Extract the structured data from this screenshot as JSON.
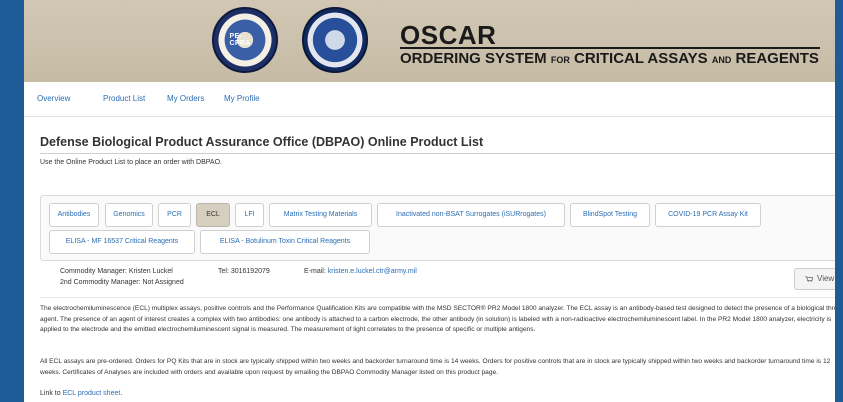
{
  "banner": {
    "seal_left_text": "PE-CPRA",
    "title": "OSCAR",
    "subtitle_parts": [
      "ORDERING SYSTEM",
      "FOR",
      "CRITICAL ASSAYS",
      "AND",
      "REAGENTS"
    ]
  },
  "nav": {
    "items": [
      "Overview",
      "Product List",
      "My Orders",
      "My Profile"
    ]
  },
  "page": {
    "title": "Defense Biological Product Assurance Office (DBPAO) Online Product List",
    "intro": "Use the Online Product List to place an order with DBPAO."
  },
  "tabs": {
    "row1": [
      "Antibodies",
      "Genomics",
      "PCR",
      "ECL",
      "LFI",
      "Matrix Testing Materials",
      "Inactivated non-BSAT Surrogates (iSURrogates)",
      "BlindSpot Testing",
      "COVID-19 PCR Assay Kit"
    ],
    "row2": [
      "ELISA - MF 16537 Critical Reagents",
      "ELISA - Botulinum Toxin Critical Reagents"
    ],
    "active": "ECL"
  },
  "manager": {
    "commodity_manager": "Commodity Manager: Kristen Luckel",
    "second_manager": "2nd Commodity Manager: Not Assigned",
    "tel": "Tel: 3016192079",
    "email_label": "E-mail:",
    "email": "kristen.e.luckel.ctr@army.mil",
    "view_button": "View"
  },
  "content": {
    "paragraph1": "The electrochemiluminescence (ECL) multiplex assays, positive controls and the Performance Qualification Kits are compatible with the MSD SECTOR® PR2 Model 1800 analyzer. The ECL assay is an antibody-based test designed to detect the presence of a biological threat agent. The presence of an agent of interest creates a complex with two antibodies: one antibody is attached to a carbon electrode, the other antibody (in solution) is labeled with a non-radioactive electrochemiluminescent label. In the PR2 Model 1800 analyzer, electricity is applied to the electrode and the emitted electrochemiluminescent signal is measured. The measurement of light correlates to the presence of specific or multiple antigens.",
    "paragraph2": "All ECL assays are pre-ordered. Orders for PQ Kits that are in stock are typically shipped within two weeks and backorder turnaround time is 14 weeks. Orders for positive controls that are in stock are typically shipped within two weeks and backorder turnaround time is 12 weeks. Certificates of Analyses are included with orders and available upon request by emailing the DBPAO Commodity Manager listed on this product page.",
    "link_prefix": "Link to ",
    "link_text": "ECL product sheet",
    "link_suffix": "."
  }
}
